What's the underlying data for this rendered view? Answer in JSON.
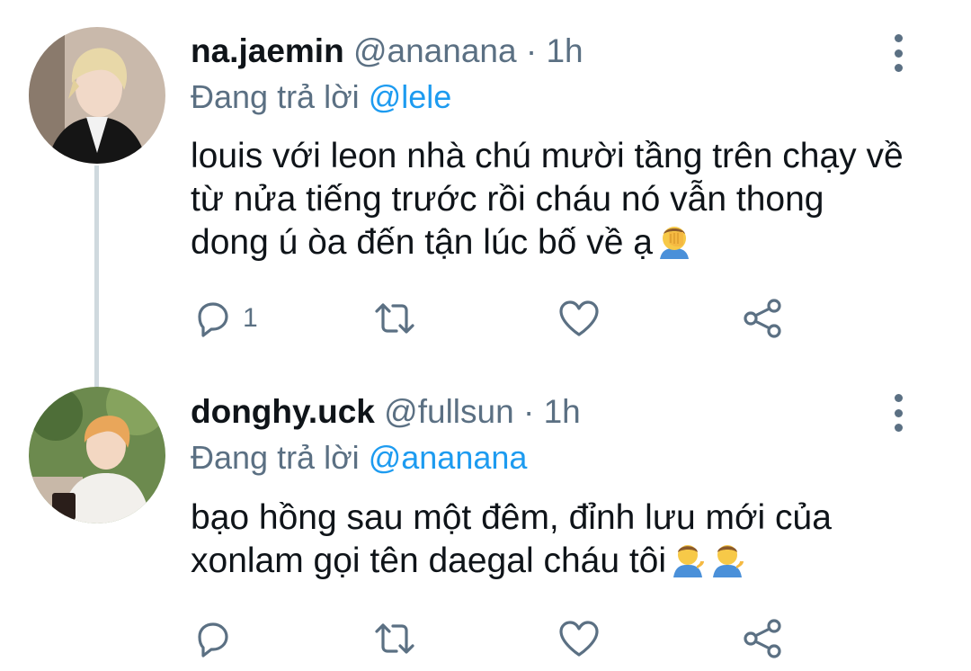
{
  "tweets": [
    {
      "display_name": "na.jaemin",
      "handle": "@ananana",
      "time": "1h",
      "reply_prefix": "Đang trả lời",
      "reply_to": "@lele",
      "text": "louis với leon nhà chú mười tầng trên chạy về từ nửa tiếng trước rồi cháu nó vẫn thong dong ú òa đến tận lúc bố về ạ",
      "emoji": [
        "face-palm-emoji"
      ],
      "reply_count": "1"
    },
    {
      "display_name": "donghy.uck",
      "handle": "@fullsun",
      "time": "1h",
      "reply_prefix": "Đang trả lời",
      "reply_to": "@ananana",
      "text": "bạo hồng sau một đêm, đỉnh lưu mới của xonlam gọi tên daegal cháu tôi",
      "emoji": [
        "person-tipping-hand-emoji",
        "person-tipping-hand-emoji"
      ],
      "reply_count": ""
    }
  ],
  "separator": "·",
  "icons": {
    "reply": "reply-icon",
    "retweet": "retweet-icon",
    "like": "heart-icon",
    "share": "share-icon",
    "more": "more-vertical-icon"
  },
  "colors": {
    "text": "#0f1419",
    "secondary": "#5b7083",
    "link": "#1d9bf0",
    "thread_line": "#cfd9de"
  }
}
